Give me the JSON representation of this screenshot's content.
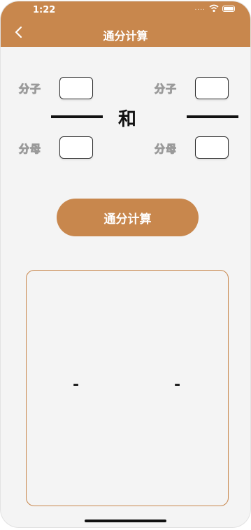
{
  "status": {
    "time": "1:22",
    "dots": "...."
  },
  "nav": {
    "title": "通分计算",
    "back_icon": "chevron-left-icon"
  },
  "left": {
    "numerator_label": "分子",
    "denominator_label": "分母",
    "numerator_value": "",
    "denominator_value": ""
  },
  "right": {
    "numerator_label": "分子",
    "denominator_label": "分母",
    "numerator_value": "",
    "denominator_value": ""
  },
  "connector": "和",
  "button": {
    "label": "通分计算"
  },
  "result": {
    "left_value": "-",
    "right_value": "-"
  },
  "colors": {
    "accent": "#c8874d",
    "background": "#f4f4f4"
  }
}
